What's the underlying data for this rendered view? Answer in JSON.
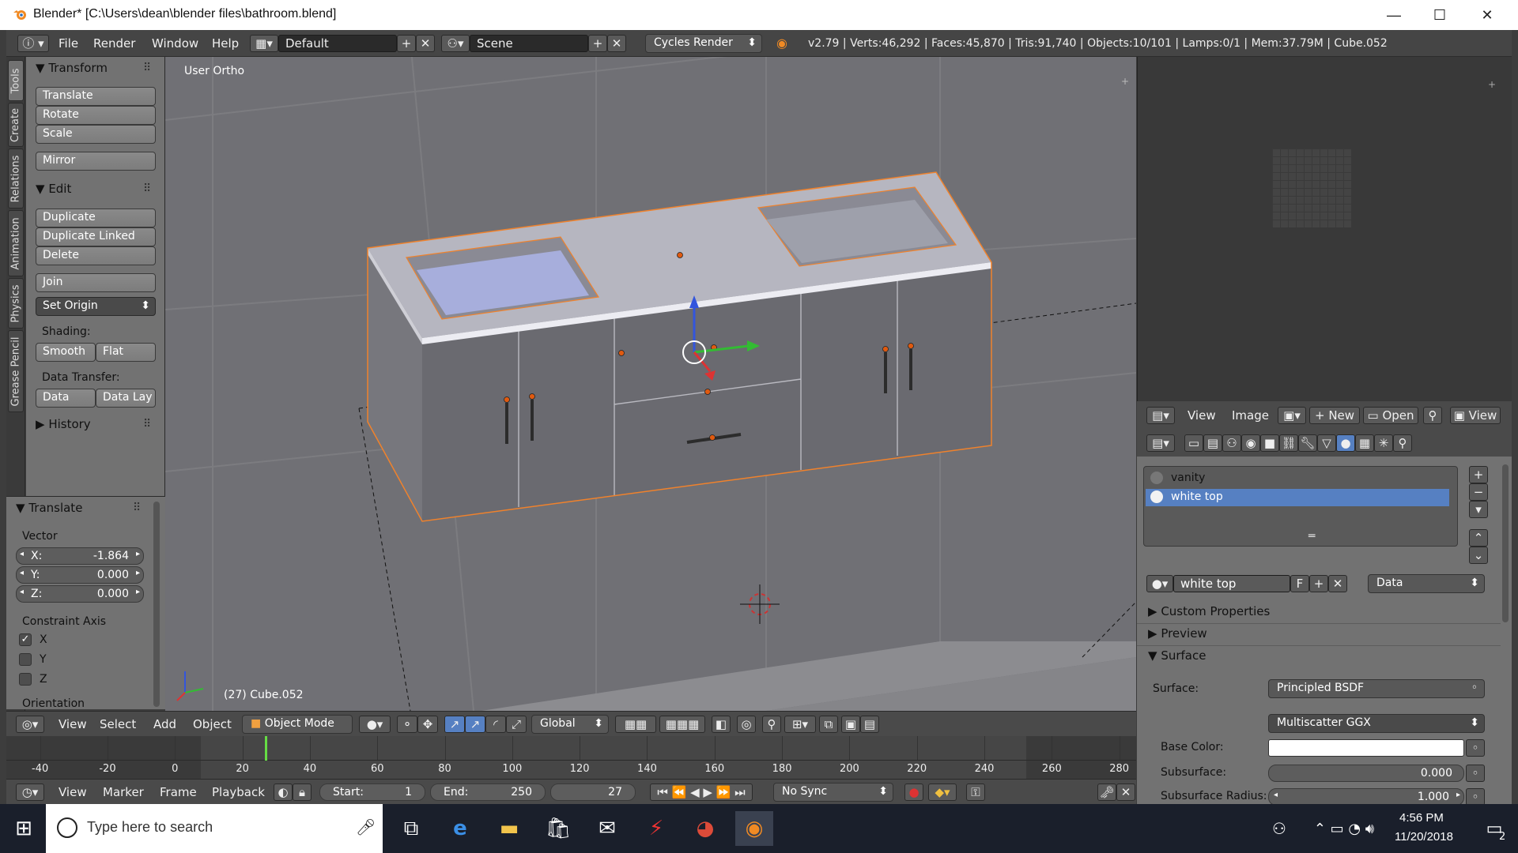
{
  "window": {
    "title": "Blender* [C:\\Users\\dean\\blender files\\bathroom.blend]",
    "minimize": "—",
    "maximize": "☐",
    "close": "✕"
  },
  "menubar": {
    "info_icon": "info-icon",
    "items": [
      "File",
      "Render",
      "Window",
      "Help"
    ],
    "layout": "Default",
    "scene": "Scene",
    "engine": "Cycles Render",
    "stats": "v2.79 | Verts:46,292 | Faces:45,870 | Tris:91,740 | Objects:10/101 | Lamps:0/1 | Mem:37.79M | Cube.052"
  },
  "tabs": [
    "Tools",
    "Create",
    "Relations",
    "Animation",
    "Physics",
    "Grease Pencil"
  ],
  "tools": {
    "transform_title": "Transform",
    "transform": [
      "Translate",
      "Rotate",
      "Scale"
    ],
    "mirror": "Mirror",
    "edit_title": "Edit",
    "edit": [
      "Duplicate",
      "Duplicate Linked",
      "Delete"
    ],
    "join": "Join",
    "set_origin": "Set Origin",
    "shading_label": "Shading:",
    "smooth": "Smooth",
    "flat": "Flat",
    "data_transfer_label": "Data Transfer:",
    "data": "Data",
    "data_lay": "Data Lay",
    "history": "History"
  },
  "operator": {
    "title": "Translate",
    "vector_label": "Vector",
    "x_label": "X:",
    "x": "-1.864",
    "y_label": "Y:",
    "y": "0.000",
    "z_label": "Z:",
    "z": "0.000",
    "constraint_label": "Constraint Axis",
    "axes": [
      "X",
      "Y",
      "Z"
    ],
    "axes_checked": [
      true,
      false,
      false
    ],
    "orientation": "Orientation"
  },
  "viewport": {
    "view_label": "User Ortho",
    "object_info": "(27) Cube.052"
  },
  "vp_header": {
    "menus": [
      "View",
      "Select",
      "Add",
      "Object"
    ],
    "mode": "Object Mode",
    "orientation": "Global"
  },
  "timeline": {
    "ticks": [
      "-40",
      "-20",
      "0",
      "20",
      "40",
      "60",
      "80",
      "100",
      "120",
      "140",
      "160",
      "180",
      "200",
      "220",
      "240",
      "260",
      "280"
    ],
    "current_frame_value": 27,
    "frame_min": -50,
    "frame_max": 285
  },
  "tl_footer": {
    "menus": [
      "View",
      "Marker",
      "Frame",
      "Playback"
    ],
    "start": "Start:",
    "start_val": "1",
    "end": "End:",
    "end_val": "250",
    "frame": "27",
    "sync": "No Sync"
  },
  "image_header": {
    "view": "View",
    "image": "Image",
    "new": "New",
    "open": "Open",
    "view2": "View"
  },
  "material": {
    "slots": [
      "vanity",
      "white top"
    ],
    "selected": 1,
    "name": "white top",
    "fake_user": "F",
    "link": "Data",
    "custom_properties": "Custom Properties",
    "preview": "Preview",
    "surface_title": "Surface",
    "surface_label": "Surface:",
    "surface_value": "Principled BSDF",
    "distribution": "Multiscatter GGX",
    "base_color_label": "Base Color:",
    "base_color": "#ffffff",
    "subsurface_label": "Subsurface:",
    "subsurface": "0.000",
    "subsurface_radius_label": "Subsurface Radius:",
    "subsurface_radius": "1.000"
  },
  "taskbar": {
    "search_placeholder": "Type here to search",
    "time": "4:56 PM",
    "date": "11/20/2018",
    "notifications": "2"
  },
  "colors": {
    "accent": "#5680c2",
    "selection": "#f0822c",
    "timeline_cursor": "#66dd44"
  }
}
